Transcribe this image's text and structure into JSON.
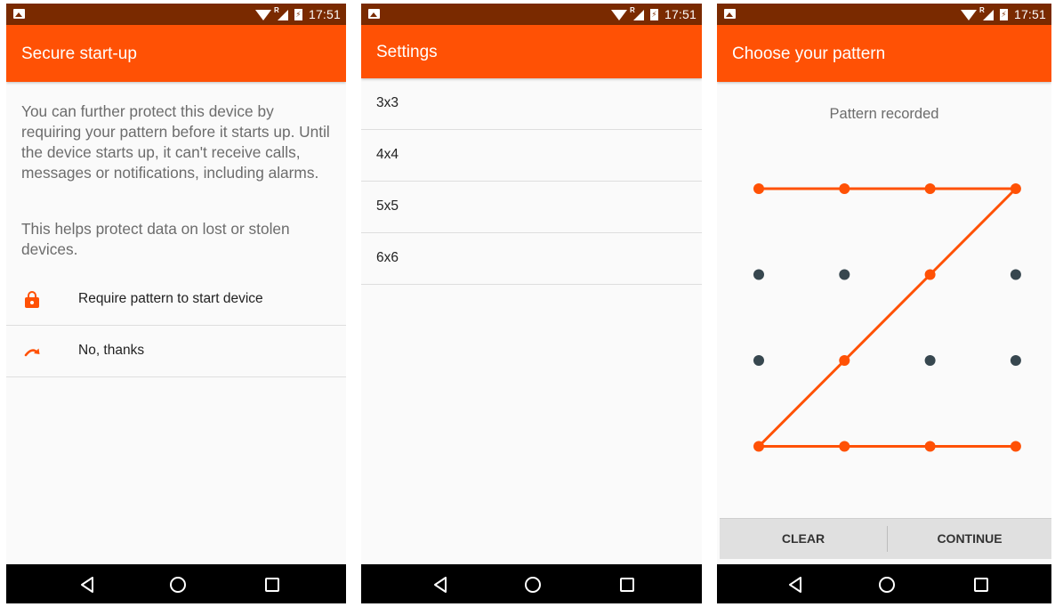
{
  "status_bar": {
    "time": "17:51",
    "icons": [
      "image-icon",
      "wifi-icon",
      "signal-icon",
      "battery-charging-icon"
    ]
  },
  "screen1": {
    "title": "Secure start-up",
    "paragraph1": "You can further protect this device by requiring your pattern before it starts up. Until the device starts up, it can't receive calls, messages or notifications, including alarms.",
    "paragraph2": "This helps protect data on lost or stolen devices.",
    "options": [
      {
        "label": "Require pattern to start device",
        "icon": "lock-icon"
      },
      {
        "label": "No, thanks",
        "icon": "skip-arrow-icon"
      }
    ]
  },
  "screen2": {
    "title": "Settings",
    "items": [
      "3x3",
      "4x4",
      "5x5",
      "6x6"
    ]
  },
  "screen3": {
    "title": "Choose your pattern",
    "message": "Pattern recorded",
    "grid_size": 4,
    "pattern_path": [
      [
        0,
        0
      ],
      [
        1,
        0
      ],
      [
        2,
        0
      ],
      [
        3,
        0
      ],
      [
        2,
        1
      ],
      [
        1,
        2
      ],
      [
        0,
        3
      ],
      [
        1,
        3
      ],
      [
        2,
        3
      ],
      [
        3,
        3
      ]
    ],
    "buttons": {
      "clear": "CLEAR",
      "continue": "CONTINUE"
    }
  },
  "nav_bar": {
    "buttons": [
      "back-icon",
      "home-icon",
      "recents-icon"
    ]
  },
  "colors": {
    "accent": "#ff5105",
    "status_bar": "#7a2a00",
    "inactive_dot": "#37474f",
    "background": "#fafafa"
  }
}
